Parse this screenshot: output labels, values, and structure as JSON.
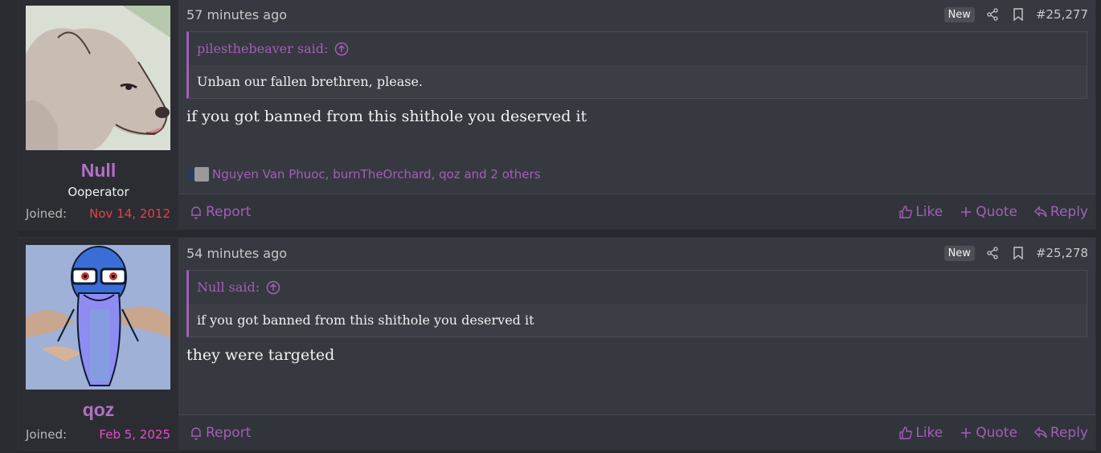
{
  "posts": [
    {
      "username": "Null",
      "user_title": "Ooperator",
      "joined_label": "Joined:",
      "joined_date": "Nov 14, 2012",
      "time": "57 minutes ago",
      "badge": "New",
      "post_number": "#25,277",
      "quote_author": "pilesthebeaver said:",
      "quote_text": "Unban our fallen brethren, please.",
      "message": "if you got banned from this shithole you deserved it",
      "reactions_text": "Nguyen Van Phuoc, burnTheOrchard, qoz and 2 others",
      "actions": {
        "report": "Report",
        "like": "Like",
        "quote": "Quote",
        "reply": "Reply"
      }
    },
    {
      "username": "qoz",
      "joined_label": "Joined:",
      "joined_date": "Feb 5, 2025",
      "time": "54 minutes ago",
      "badge": "New",
      "post_number": "#25,278",
      "quote_author": "Null said:",
      "quote_text": "if you got banned from this shithole you deserved it",
      "message": "they were targeted",
      "actions": {
        "report": "Report",
        "like": "Like",
        "quote": "Quote",
        "reply": "Reply"
      }
    }
  ],
  "colors": {
    "accent": "#a25fb6",
    "username": "#b46fc6",
    "joined_red": "#e6414a",
    "joined_pink": "#e64ec8",
    "post_bg": "#363940",
    "user_bg": "#2b2d32"
  },
  "icons": [
    "share-icon",
    "bookmark-icon",
    "arrow-up-circle-icon",
    "bell-icon",
    "thumbs-up-icon",
    "plus-icon",
    "reply-icon"
  ]
}
